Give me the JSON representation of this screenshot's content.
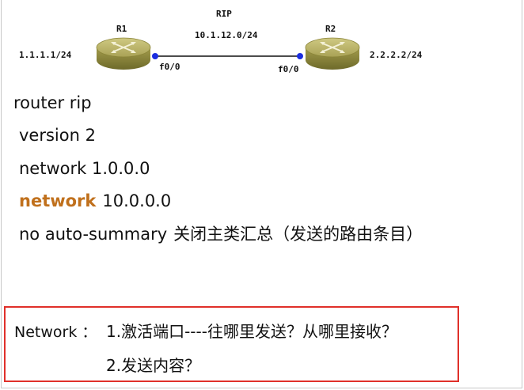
{
  "topology": {
    "protocol": "RIP",
    "link_network": "10.1.12.0/24",
    "r1": {
      "name": "R1",
      "loopback": "1.1.1.1/24",
      "interface": "f0/0"
    },
    "r2": {
      "name": "R2",
      "loopback": "2.2.2.2/24",
      "interface": "f0/0"
    },
    "colors": {
      "router_body": "#8a8438",
      "router_top": "#b6b060",
      "link": "#111111",
      "port_dot": "#1b2de0"
    }
  },
  "config": {
    "line1": "router rip",
    "line2": "version 2",
    "line3": "network 1.0.0.0",
    "line4_keyword": "network",
    "line4_value": "10.0.0.0",
    "line5_cmd": "no auto-summary",
    "line5_comment": "关闭主类汇总（发送的路由条目）",
    "keyword_color": "#c0701c"
  },
  "note": {
    "label": "Network ：",
    "item1": "1.激活端口----往哪里发送？从哪里接收？",
    "item2": "2.发送内容？",
    "border_color": "#e0302a"
  }
}
